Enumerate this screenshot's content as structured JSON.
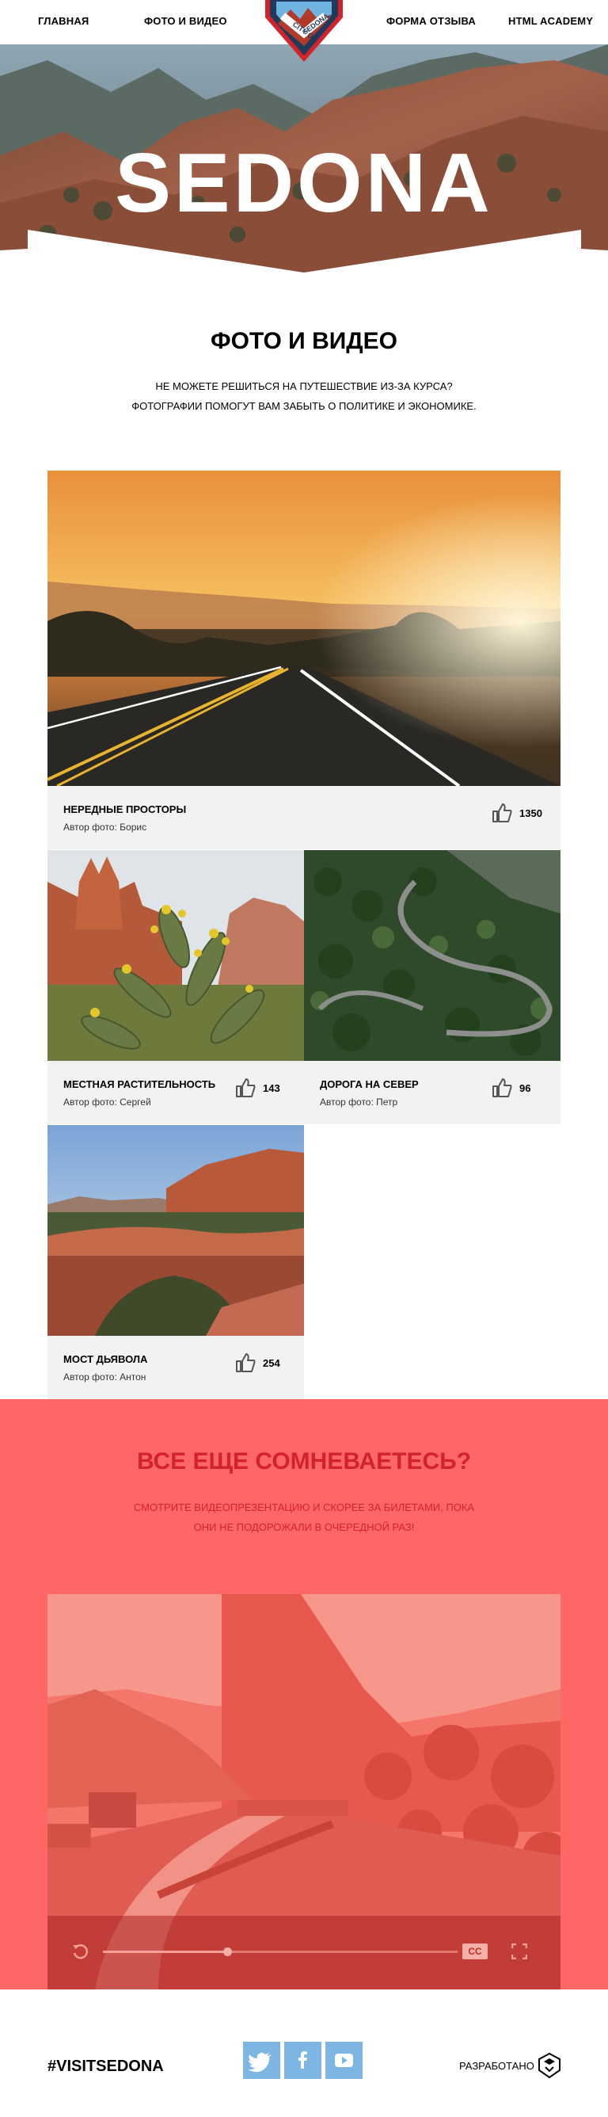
{
  "nav": {
    "items": [
      "Главная",
      "Фото и видео",
      "Форма отзыва",
      "HTML Academy"
    ]
  },
  "logo": {
    "top_text": "CITY OF",
    "bottom_text": "SEDONA"
  },
  "hero": {
    "title": "SEDONA"
  },
  "intro": {
    "title": "ФОТО И ВИДЕО",
    "line1": "НЕ МОЖЕТЕ РЕШИТЬСЯ НА ПУТЕШЕСТВИЕ ИЗ-ЗА КУРСА?",
    "line2": "ФОТОГРАФИИ ПОМОГУТ ВАМ ЗАБЫТЬ О ПОЛИТИКЕ И ЭКОНОМИКЕ."
  },
  "gallery": [
    {
      "title": "Нередные просторы",
      "author": "Автор фото: Борис",
      "likes": "1350"
    },
    {
      "title": "Местная растительность",
      "author": "Автор фото: Сергей",
      "likes": "143"
    },
    {
      "title": "Дорога на север",
      "author": "Автор фото: Петр",
      "likes": "96"
    },
    {
      "title": "Мост дьявола",
      "author": "Автор фото: Антон",
      "likes": "254"
    }
  ],
  "doubts": {
    "title": "ВСЕ ЕЩЕ СОМНЕВАЕТЕСЬ?",
    "line1": "СМОТРИТЕ ВИДЕОПРЕЗЕНТАЦИЮ И СКОРЕЕ ЗА БИЛЕТАМИ, ПОКА",
    "line2": "ОНИ НЕ ПОДОРОЖАЛИ В ОЧЕРЕДНОЙ РАЗ!"
  },
  "video": {
    "cc_label": "CC",
    "progress": 0.35
  },
  "footer": {
    "hashtag": "#VISITSEDONA",
    "social": [
      "twitter-icon",
      "facebook-icon",
      "youtube-icon"
    ],
    "developed": "Разработано"
  },
  "colors": {
    "accent": "#ff6767",
    "accent_dark": "#d2232a",
    "social": "#7db5e3",
    "caption_bg": "#f2f2f2"
  }
}
